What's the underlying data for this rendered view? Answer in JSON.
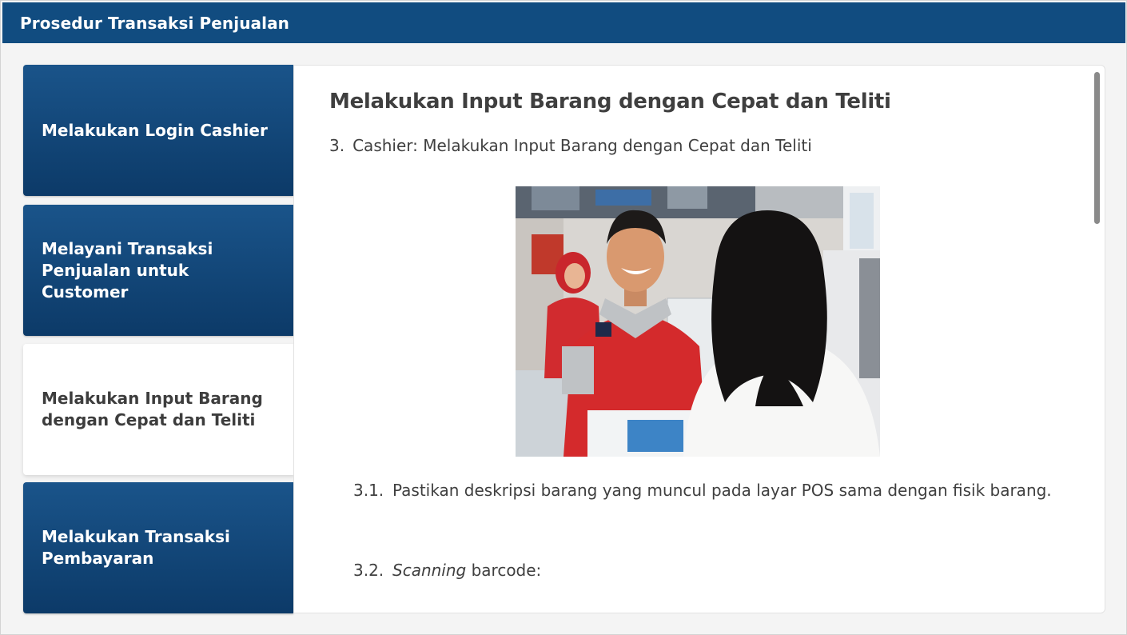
{
  "header": {
    "title": "Prosedur Transaksi Penjualan"
  },
  "sidebar": {
    "items": [
      {
        "label": "Melakukan Login Cashier",
        "active": false
      },
      {
        "label": "Melayani Transaksi Penjualan untuk Customer",
        "active": false
      },
      {
        "label": "Melakukan Input Barang dengan Cepat dan Teliti",
        "active": true
      },
      {
        "label": "Melakukan Transaksi Pembayaran",
        "active": false
      }
    ]
  },
  "content": {
    "title": "Melakukan Input Barang dengan Cepat dan Teliti",
    "step": {
      "number": "3.",
      "text": "Cashier: Melakukan Input Barang dengan Cepat dan Teliti"
    },
    "image": {
      "name": "cashier-serving-customer-photo"
    },
    "substeps": [
      {
        "number": "3.1.",
        "text": "Pastikan deskripsi barang yang muncul pada layar POS sama dengan fisik barang."
      },
      {
        "number": "3.2.",
        "italic": "Scanning",
        "text": " barcode:"
      }
    ]
  },
  "colors": {
    "header_bg": "#114c80",
    "nav_bg": "#0f4272",
    "nav_active_bg": "#ffffff",
    "text": "#3f3f3f"
  }
}
